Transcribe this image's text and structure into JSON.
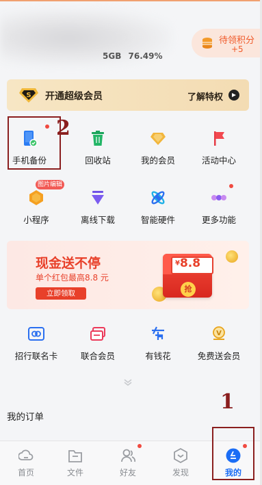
{
  "header": {
    "storage_used": "5GB",
    "storage_percent": "76.49%",
    "points_label": "待领积分",
    "points_value": "+5"
  },
  "vip_banner": {
    "title": "开通超级会员",
    "more": "了解特权"
  },
  "grid_row1": [
    {
      "label": "手机备份",
      "icon": "phone-backup-icon",
      "dot": true
    },
    {
      "label": "回收站",
      "icon": "trash-icon",
      "dot": false
    },
    {
      "label": "我的会员",
      "icon": "diamond-icon",
      "dot": false
    },
    {
      "label": "活动中心",
      "icon": "flag-icon",
      "dot": false
    }
  ],
  "grid_row2": [
    {
      "label": "小程序",
      "icon": "mini-program-icon",
      "tag": "图片编辑"
    },
    {
      "label": "离线下载",
      "icon": "download-icon"
    },
    {
      "label": "智能硬件",
      "icon": "hardware-icon"
    },
    {
      "label": "更多功能",
      "icon": "more-dots-icon",
      "dot": true
    }
  ],
  "promo": {
    "title": "现金送不停",
    "subtitle": "单个红包最高8.8 元",
    "button": "立即领取",
    "amount_symbol": "¥",
    "amount": "8.8",
    "grab": "抢"
  },
  "services": [
    {
      "label": "招行联名卡",
      "icon": "bank-card-icon"
    },
    {
      "label": "联合会员",
      "icon": "joint-member-icon"
    },
    {
      "label": "有钱花",
      "icon": "loan-icon"
    },
    {
      "label": "免费送会员",
      "icon": "gift-member-icon"
    }
  ],
  "orders": {
    "title": "我的订单"
  },
  "tabs": [
    {
      "label": "首页",
      "icon": "home-cloud-icon"
    },
    {
      "label": "文件",
      "icon": "folder-icon"
    },
    {
      "label": "好友",
      "icon": "friends-icon",
      "dot": true
    },
    {
      "label": "发现",
      "icon": "discover-icon"
    },
    {
      "label": "我的",
      "icon": "profile-icon",
      "dot": true,
      "active": true
    }
  ],
  "annotations": {
    "mark_one": "1",
    "mark_two": "2"
  },
  "colors": {
    "accent_blue": "#1b6df5",
    "promo_red": "#e8402a",
    "annotation": "#8a1e1e"
  }
}
